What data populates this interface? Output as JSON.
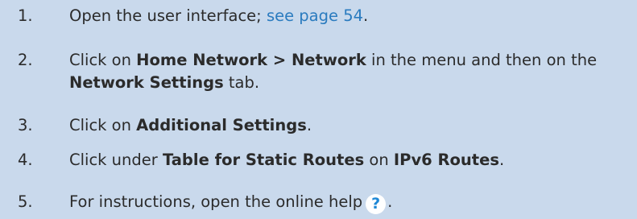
{
  "steps": [
    {
      "number": "1.",
      "text": "Open the user interface; ",
      "link": "see page 54",
      "end": "."
    },
    {
      "number": "2.",
      "text1": "Click on ",
      "bold1": "Home Network > Network",
      "text2": " in the menu and then on the",
      "bold2": "Network Settings",
      "text3": " tab."
    },
    {
      "number": "3.",
      "text1": "Click on ",
      "bold1": "Additional Settings",
      "end": "."
    },
    {
      "number": "4.",
      "text1": "Click under ",
      "bold1": "Table for Static Routes",
      "text2": " on ",
      "bold2": "IPv6 Routes",
      "end": "."
    },
    {
      "number": "5.",
      "text": "For instructions, open the online help",
      "icon": "?",
      "end": "."
    }
  ]
}
